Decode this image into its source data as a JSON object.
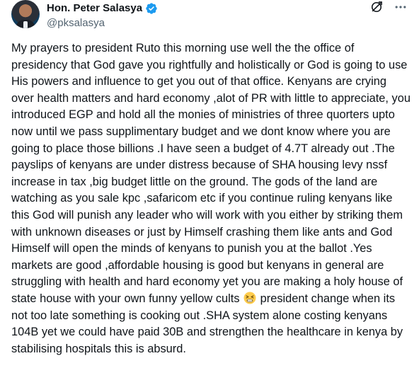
{
  "author": {
    "display_name": "Hon. Peter Salasya",
    "handle": "@pksalasya",
    "verified": true,
    "verified_color": "#1d9bf0"
  },
  "icons": {
    "grok": "grok-icon",
    "more": "more-icon",
    "emoji": "tired-face-emoji"
  },
  "tweet": {
    "text_part1": "My prayers to president Ruto this morning use well  the  the office of presidency that God gave you rightfully and holistically or God is going to use His powers and influence to get you out of that office. Kenyans are crying over health matters and hard economy ,alot of PR with little to appreciate, you introduced EGP and hold all the monies of ministries of three quorters upto now until we pass supplimentary budget and we dont know where you are going to place those billions  .I have seen a budget of 4.7T already out .The payslips of kenyans are under distress because of SHA housing levy nssf increase in tax ,big budget little on the ground. The gods of the land are watching as you sale kpc ,safaricom etc if you continue ruling kenyans like this God will punish any leader who will work with you either by striking them with unknown diseases or just by Himself crashing them like ants and God Himself will open the minds of kenyans to punish you at the ballot .Yes markets are good ,affordable housing is good but kenyans in general are struggling with health and hard economy yet you are making a holy house of state house with your own funny yellow cults",
    "text_part2": "president change when its not too late something is cooking out .SHA system alone costing kenyans 104B yet we could have paid 30B and strengthen the healthcare in kenya by stabilising hospitals this is absurd."
  }
}
